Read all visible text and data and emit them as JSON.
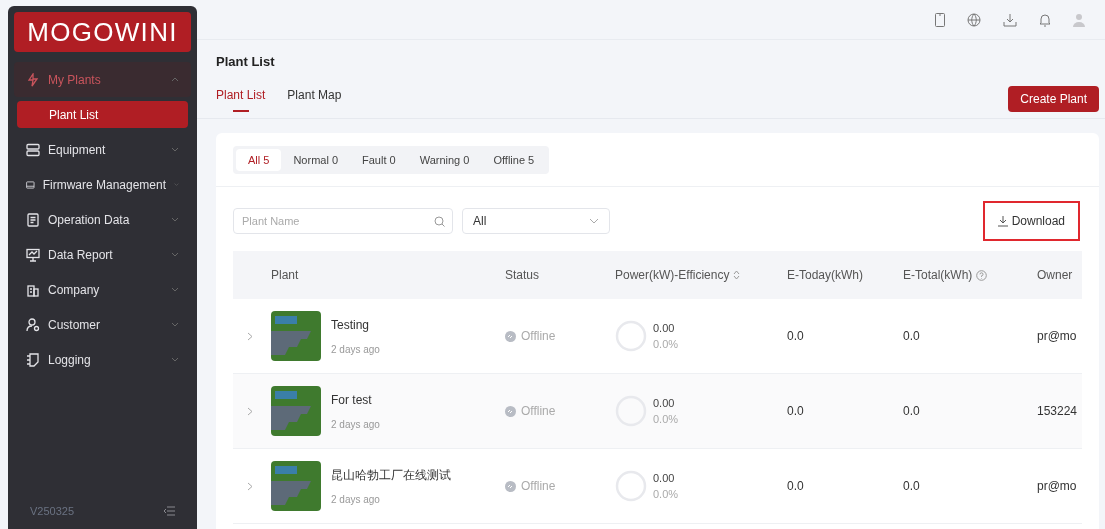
{
  "sidebar": {
    "logo": "MOGOWINI",
    "items": [
      {
        "label": "My Plants",
        "expanded": true,
        "children": [
          {
            "label": "Plant List",
            "selected": true
          }
        ]
      },
      {
        "label": "Equipment",
        "expanded": false
      },
      {
        "label": "Firmware Management",
        "expanded": false
      },
      {
        "label": "Operation Data",
        "expanded": false
      },
      {
        "label": "Data Report",
        "expanded": false
      },
      {
        "label": "Company",
        "expanded": false
      },
      {
        "label": "Customer",
        "expanded": false
      },
      {
        "label": "Logging",
        "expanded": false
      }
    ],
    "version": "V250325"
  },
  "page": {
    "title": "Plant List",
    "tabs": [
      {
        "label": "Plant List",
        "selected": true
      },
      {
        "label": "Plant Map",
        "selected": false
      }
    ],
    "create_button": "Create Plant"
  },
  "status_filters": [
    {
      "label": "All 5",
      "selected": true
    },
    {
      "label": "Normal 0",
      "selected": false
    },
    {
      "label": "Fault 0",
      "selected": false
    },
    {
      "label": "Warning 0",
      "selected": false
    },
    {
      "label": "Offline 5",
      "selected": false
    }
  ],
  "search": {
    "placeholder": "Plant Name"
  },
  "status_select": {
    "value": "All"
  },
  "download": {
    "label": "Download",
    "highlighted": true
  },
  "table": {
    "columns": [
      "Plant",
      "Status",
      "Power(kW)-Efficiency",
      "E-Today(kWh)",
      "E-Total(kWh)",
      "Owner"
    ],
    "rows": [
      {
        "name": "Testing",
        "time": "2 days ago",
        "status": "Offline",
        "power": "0.00",
        "efficiency": "0.0%",
        "e_today": "0.0",
        "e_total": "0.0",
        "owner": "pr@mo"
      },
      {
        "name": "For test",
        "time": "2 days ago",
        "status": "Offline",
        "power": "0.00",
        "efficiency": "0.0%",
        "e_today": "0.0",
        "e_total": "0.0",
        "owner": "153224"
      },
      {
        "name": "昆山哈勃工厂在线测试",
        "time": "2 days ago",
        "status": "Offline",
        "power": "0.00",
        "efficiency": "0.0%",
        "e_today": "0.0",
        "e_total": "0.0",
        "owner": "pr@mo"
      }
    ]
  }
}
